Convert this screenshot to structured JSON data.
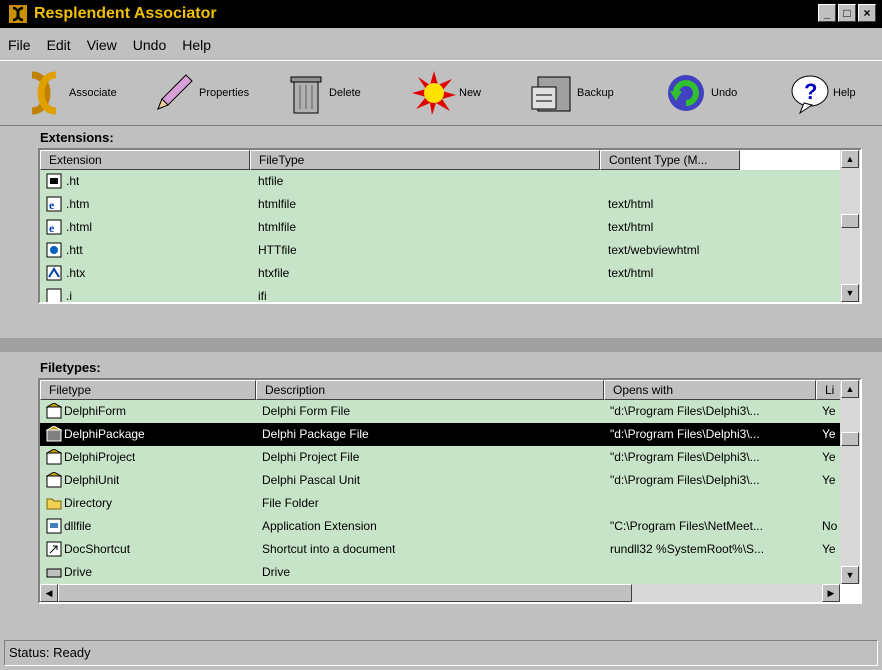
{
  "window": {
    "title": "Resplendent Associator",
    "btn_min": "_",
    "btn_max": "□",
    "btn_close": "×"
  },
  "menu": [
    {
      "label": "File"
    },
    {
      "label": "Edit"
    },
    {
      "label": "View"
    },
    {
      "label": "Undo"
    },
    {
      "label": "Help"
    }
  ],
  "toolbar": {
    "associate": "Associate",
    "properties": "Properties",
    "delete": "Delete",
    "new": "New",
    "backup": "Backup",
    "undo": "Undo",
    "help": "Help"
  },
  "extensions": {
    "label": "Extensions:",
    "columns": [
      "Extension",
      "FileType",
      "Content Type (M..."
    ],
    "rows": [
      {
        "ext": ".ht",
        "type": "htfile",
        "content": ""
      },
      {
        "ext": ".htm",
        "type": "htmlfile",
        "content": "text/html"
      },
      {
        "ext": ".html",
        "type": "htmlfile",
        "content": "text/html"
      },
      {
        "ext": ".htt",
        "type": "HTTfile",
        "content": "text/webviewhtml"
      },
      {
        "ext": ".htx",
        "type": "htxfile",
        "content": "text/html"
      },
      {
        "ext": ".i",
        "type": "ifi",
        "content": ""
      }
    ]
  },
  "filetypes": {
    "label": "Filetypes:",
    "columns": [
      "Filetype",
      "Description",
      "Opens with",
      "Li"
    ],
    "rows": [
      {
        "name": "DelphiForm",
        "desc": "Delphi Form File",
        "opens": "\"d:\\Program Files\\Delphi3\\...",
        "li": "Ye"
      },
      {
        "name": "DelphiPackage",
        "desc": "Delphi Package File",
        "opens": "\"d:\\Program Files\\Delphi3\\...",
        "li": "Ye"
      },
      {
        "name": "DelphiProject",
        "desc": "Delphi Project File",
        "opens": "\"d:\\Program Files\\Delphi3\\...",
        "li": "Ye"
      },
      {
        "name": "DelphiUnit",
        "desc": "Delphi Pascal Unit",
        "opens": "\"d:\\Program Files\\Delphi3\\...",
        "li": "Ye"
      },
      {
        "name": "Directory",
        "desc": "File Folder",
        "opens": "",
        "li": ""
      },
      {
        "name": "dllfile",
        "desc": "Application Extension",
        "opens": "\"C:\\Program Files\\NetMeet...",
        "li": "No"
      },
      {
        "name": "DocShortcut",
        "desc": "Shortcut into a document",
        "opens": "rundll32 %SystemRoot%\\S...",
        "li": "Ye"
      },
      {
        "name": "Drive",
        "desc": "Drive",
        "opens": "",
        "li": ""
      }
    ]
  },
  "status": {
    "text": "Status: Ready"
  }
}
